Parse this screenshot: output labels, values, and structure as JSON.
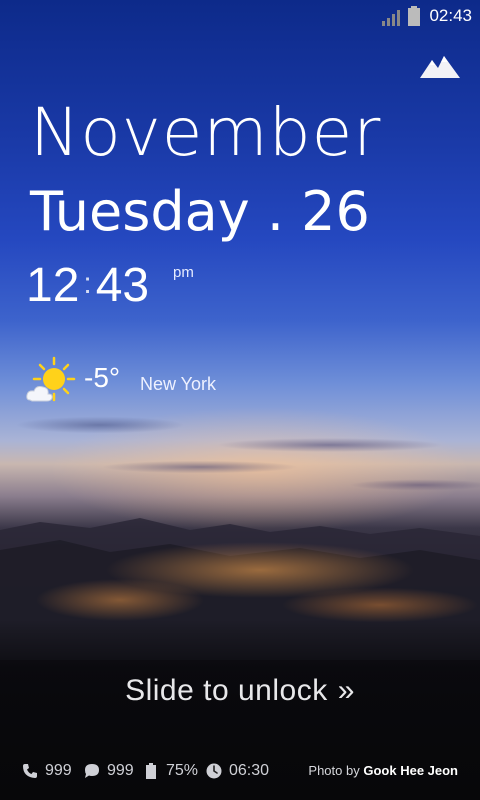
{
  "status_bar": {
    "time": "02:43"
  },
  "date": {
    "month": "November",
    "day_line": "Tuesday . 26"
  },
  "clock": {
    "hours": "12",
    "separator": ":",
    "minutes": "43",
    "ampm": "pm"
  },
  "weather": {
    "temperature": "-5°",
    "city": "New York",
    "icon": "sun-cloud-icon"
  },
  "unlock": {
    "label": "Slide to unlock",
    "chevron": "»"
  },
  "notifications": {
    "missed_calls": "999",
    "messages": "999",
    "battery": "75%",
    "alarm": "06:30"
  },
  "credit": {
    "prefix": "Photo by",
    "author": "Gook Hee Jeon"
  }
}
